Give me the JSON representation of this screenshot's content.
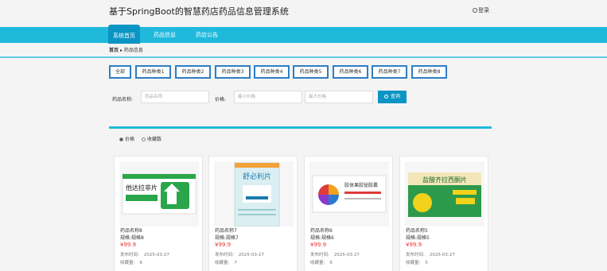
{
  "header": {
    "title": "基于SpringBoot的智慧药店药品信息管理系统",
    "login": "登录"
  },
  "nav": [
    "系统首页",
    "药品信息",
    "药店公告"
  ],
  "breadcrumb": {
    "home": "首页",
    "sep": "▸",
    "current": "药品信息"
  },
  "categories": [
    "全部",
    "药品种类1",
    "药品种类2",
    "药品种类3",
    "药品种类4",
    "药品种类5",
    "药品种类6",
    "药品种类7",
    "药品种类8"
  ],
  "search": {
    "name_label": "药品名称:",
    "name_placeholder": "药品名称",
    "price_label": "价格:",
    "min_placeholder": "最小价格",
    "max_placeholder": "最大价格",
    "button": "查询"
  },
  "sort": {
    "price": "价格",
    "favs": "收藏数"
  },
  "products": [
    {
      "name": "药品名称8",
      "spec": "规格:规格8",
      "price": "¥99.9",
      "time_label": "发布时间:",
      "time": "2025-03-27",
      "fav_label": "收藏量:",
      "favs": "8",
      "box_text": "他达拉非片"
    },
    {
      "name": "药品名称7",
      "spec": "规格:规格7",
      "price": "¥99.9",
      "time_label": "发布时间:",
      "time": "2025-03-27",
      "fav_label": "收藏量:",
      "favs": "7",
      "box_text": "舒必利片"
    },
    {
      "name": "药品名称6",
      "spec": "规格:规格6",
      "price": "¥99.9",
      "time_label": "发布时间:",
      "time": "2025-03-27",
      "fav_label": "收藏量:",
      "favs": "6",
      "box_text": "胶体果胶铋胶囊"
    },
    {
      "name": "药品名称5",
      "spec": "规格:规格5",
      "price": "¥99.9",
      "time_label": "发布时间:",
      "time": "2025-03-27",
      "fav_label": "收藏量:",
      "favs": "5",
      "box_text": "盐酸齐拉西酮片"
    }
  ],
  "colors": {
    "accent": "#1fb9dc",
    "nav_active": "#0b95c4",
    "price": "#e33333",
    "category_border": "#2d7fc5"
  }
}
